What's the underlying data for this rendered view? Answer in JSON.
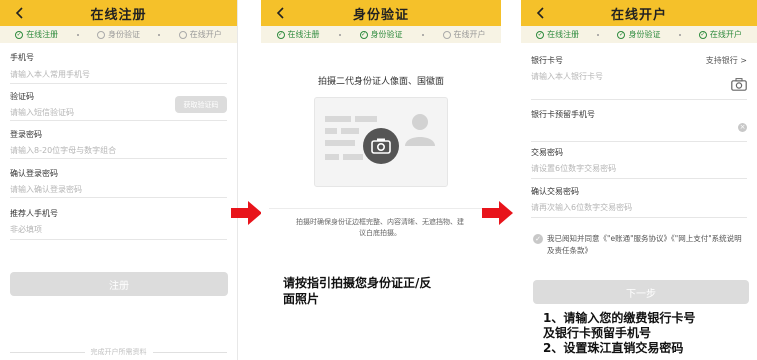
{
  "step_labels": [
    "在线注册",
    "身份验证",
    "在线开户"
  ],
  "screen1": {
    "title": "在线注册",
    "fields": [
      {
        "label": "手机号",
        "placeholder": "请输入本人常用手机号"
      },
      {
        "label": "验证码",
        "placeholder": "请输入短信验证码"
      },
      {
        "label": "登录密码",
        "placeholder": "请输入8-20位字母与数字组合"
      },
      {
        "label": "确认登录密码",
        "placeholder": "请输入确认登录密码"
      },
      {
        "label": "推荐人手机号",
        "placeholder": "非必填项"
      }
    ],
    "get_code_button": "获取验证码",
    "submit_button": "注册",
    "footer_text": "完成开户所需资料"
  },
  "screen2": {
    "title": "身份验证",
    "instruction": "拍摄二代身份证人像面、国徽面",
    "tip": "拍摄时确保身份证边框完整、内容清晰、无遮挡物、建议白底拍摄。"
  },
  "screen3": {
    "title": "在线开户",
    "fields": [
      {
        "label": "银行卡号",
        "placeholder": "请输入本人银行卡号"
      },
      {
        "label": "银行卡预留手机号",
        "placeholder": ""
      },
      {
        "label": "交易密码",
        "placeholder": "请设置6位数字交易密码"
      },
      {
        "label": "确认交易密码",
        "placeholder": "请再次输入6位数字交易密码"
      }
    ],
    "supported_banks": "支持银行 >",
    "agreement": "我已阅知并同意《\"e账通\"服务协议》《\"网上支付\"系统说明及责任条款》",
    "next_button": "下一步"
  },
  "notes": {
    "middle_line1": "请按指引拍摄您身份证正/反",
    "middle_line2": "面照片",
    "right_line1": "1、请输入您的缴费银行卡号",
    "right_line2": "及银行卡预留手机号",
    "right_line3": "2、设置珠江直销交易密码"
  },
  "colors": {
    "header": "#f5c12a",
    "step_bar": "#f7f3e4",
    "step_done": "#2e8b3e",
    "arrow": "#e8141b"
  }
}
